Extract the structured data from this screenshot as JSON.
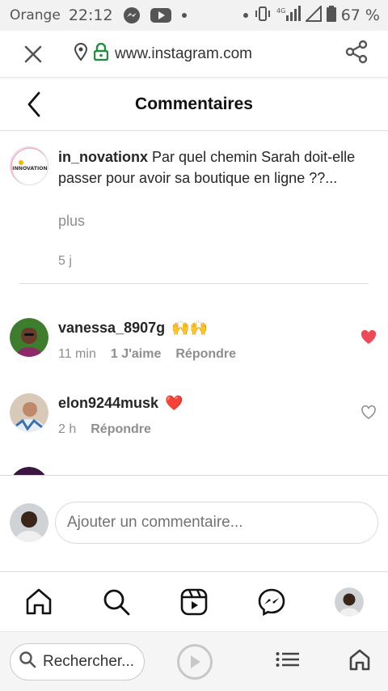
{
  "status_bar": {
    "carrier": "Orange",
    "time": "22:12",
    "network": "4G",
    "battery": "67 %"
  },
  "browser": {
    "url": "www.instagram.com",
    "search_label": "Rechercher...",
    "icons": [
      "close-icon",
      "location-pin-icon",
      "lock-icon",
      "share-icon",
      "search-icon",
      "play-icon",
      "list-icon",
      "home-icon"
    ]
  },
  "header": {
    "title": "Commentaires"
  },
  "caption": {
    "username": "in_novationx",
    "text": "Par quel chemin Sarah doit-elle passer pour avoir sa boutique en ligne ??...",
    "more": "plus",
    "age": "5 j",
    "avatar_label": "INNOVATION"
  },
  "comments": [
    {
      "username": "vanessa_8907g",
      "emoji": "🙌🙌",
      "age": "11 min",
      "likes": "1 J'aime",
      "reply": "Répondre",
      "liked": true
    },
    {
      "username": "elon9244musk",
      "emoji": "❤️",
      "age": "2 h",
      "reply": "Répondre",
      "liked": false
    }
  ],
  "comment_input": {
    "placeholder": "Ajouter un commentaire..."
  },
  "colors": {
    "like_red": "#ed4956",
    "muted": "#8e8e8e",
    "text": "#262626",
    "border": "#dbdbdb",
    "secure_green": "#1e8e3e"
  }
}
